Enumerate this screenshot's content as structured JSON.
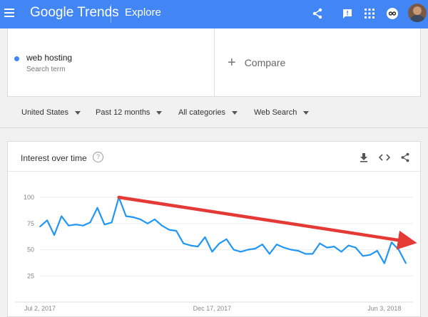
{
  "header": {
    "brand_google": "Google",
    "brand_trends": "Trends",
    "page": "Explore",
    "icons": [
      "menu-icon",
      "share-icon",
      "feedback-icon",
      "apps-icon",
      "notification-icon",
      "account-avatar"
    ]
  },
  "search": {
    "term": "web hosting",
    "term_sub": "Search term",
    "term_color": "#4285f4",
    "compare_label": "Compare"
  },
  "filters": [
    {
      "label": "United States"
    },
    {
      "label": "Past 12 months"
    },
    {
      "label": "All categories"
    },
    {
      "label": "Web Search"
    }
  ],
  "card": {
    "title": "Interest over time",
    "help": "?",
    "icons": [
      "download-icon",
      "embed-icon",
      "share-icon"
    ]
  },
  "chart_data": {
    "type": "line",
    "title": "",
    "xlabel": "",
    "ylabel": "",
    "ylim": [
      0,
      100
    ],
    "yticks": [
      25,
      50,
      75,
      100
    ],
    "xtick_labels": [
      "Jul 2, 2017",
      "Dec 17, 2017",
      "Jun 3, 2018"
    ],
    "xtick_index": [
      0,
      24,
      48
    ],
    "grid": true,
    "series": [
      {
        "color": "#2196f3",
        "values": [
          72,
          78,
          64,
          82,
          73,
          74,
          73,
          76,
          90,
          74,
          76,
          100,
          82,
          81,
          79,
          75,
          79,
          73,
          69,
          68,
          56,
          54,
          53,
          62,
          48,
          56,
          60,
          50,
          48,
          50,
          51,
          55,
          46,
          55,
          52,
          50,
          49,
          46,
          46,
          56,
          52,
          53,
          48,
          54,
          52,
          44,
          45,
          49,
          37,
          57,
          50,
          37
        ]
      }
    ],
    "annotation": {
      "type": "arrow",
      "color": "#e53935",
      "from_index": 11,
      "from_value": 100,
      "to_index": 51,
      "to_value": 58
    }
  }
}
